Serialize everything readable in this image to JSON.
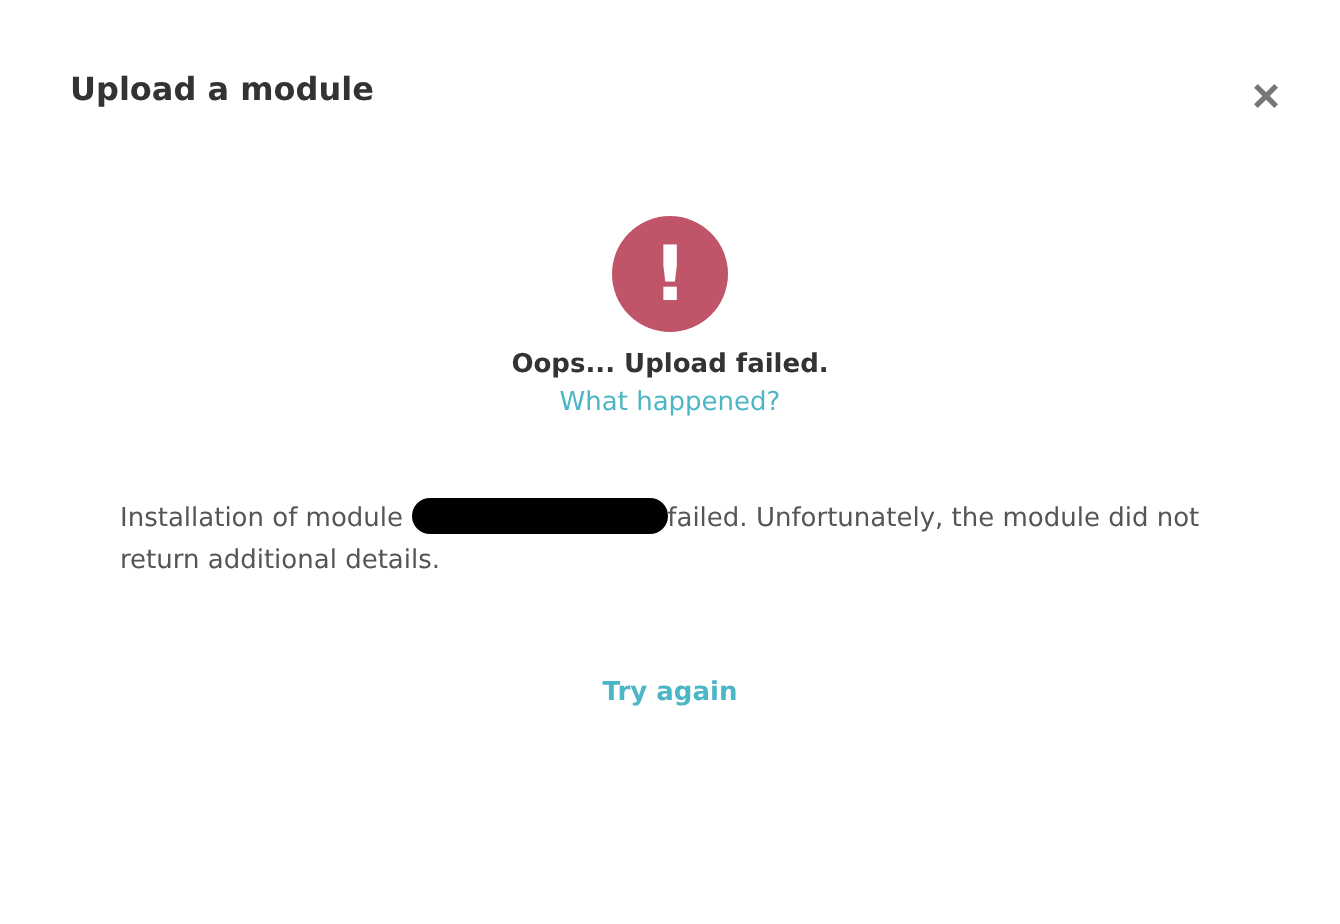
{
  "dialog": {
    "title": "Upload a module",
    "close": "×"
  },
  "status": {
    "icon": "!",
    "heading": "Oops... Upload failed.",
    "link": "What happened?"
  },
  "message": {
    "before": "Installation of module ",
    "after": "failed. Unfortunately, the module did not return additional details."
  },
  "action": "Try again"
}
